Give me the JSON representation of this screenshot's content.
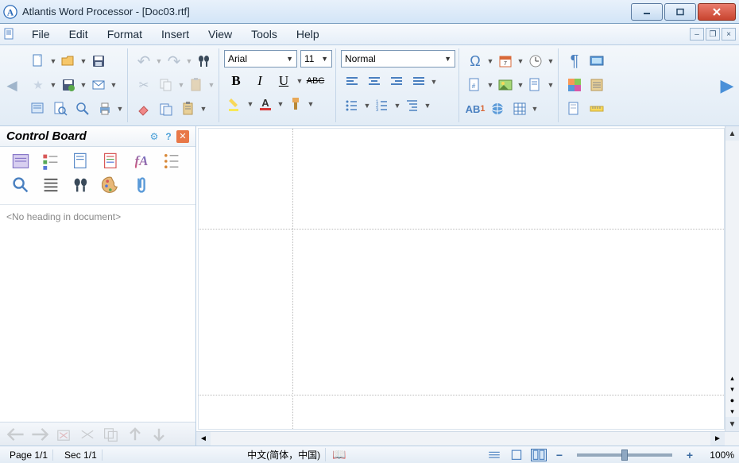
{
  "window": {
    "title": "Atlantis Word Processor - [Doc03.rtf]"
  },
  "menu": {
    "items": [
      "File",
      "Edit",
      "Format",
      "Insert",
      "View",
      "Tools",
      "Help"
    ]
  },
  "toolbar": {
    "font_name": "Arial",
    "font_size": "11",
    "style_name": "Normal",
    "bold": "B",
    "italic": "I",
    "underline": "U",
    "strike": "ABC"
  },
  "sidebar": {
    "title": "Control Board",
    "empty_message": "<No heading in document>"
  },
  "statusbar": {
    "page": "Page 1/1",
    "section": "Sec 1/1",
    "language": "中文(简体，中国)",
    "zoom": "100%"
  }
}
